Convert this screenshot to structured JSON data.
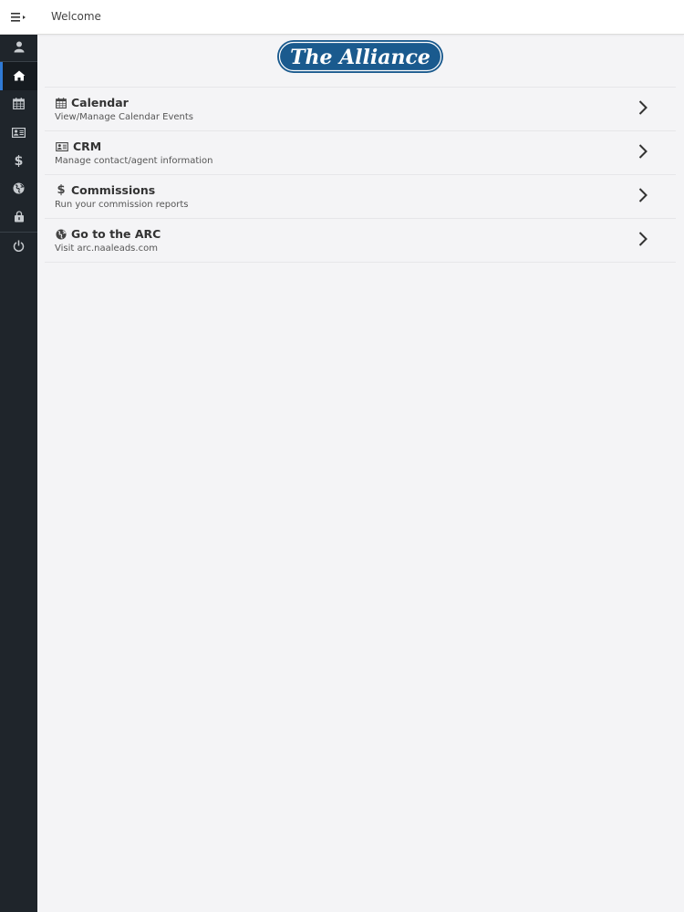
{
  "header": {
    "title": "Welcome",
    "menu_icon": "hamburger-menu-icon"
  },
  "sidebar": {
    "items": [
      {
        "icon": "user-icon",
        "active": false
      },
      {
        "icon": "home-icon",
        "active": true
      },
      {
        "icon": "calendar-icon",
        "active": false
      },
      {
        "icon": "contact-card-icon",
        "active": false
      },
      {
        "icon": "dollar-icon",
        "active": false
      },
      {
        "icon": "globe-icon",
        "active": false
      },
      {
        "icon": "briefcase-lock-icon",
        "active": false
      },
      {
        "icon": "power-icon",
        "active": false
      }
    ],
    "active_color": "#2f7ad6"
  },
  "logo": {
    "text": "The Alliance",
    "color": "#1a5a8e"
  },
  "menu": [
    {
      "icon": "calendar-icon",
      "title": "Calendar",
      "subtitle": "View/Manage Calendar Events"
    },
    {
      "icon": "contact-card-icon",
      "title": "CRM",
      "subtitle": "Manage contact/agent information"
    },
    {
      "icon": "dollar-icon",
      "title": "Commissions",
      "subtitle": "Run your commission reports"
    },
    {
      "icon": "globe-icon",
      "title": "Go to the ARC",
      "subtitle": "Visit arc.naaleads.com"
    }
  ]
}
